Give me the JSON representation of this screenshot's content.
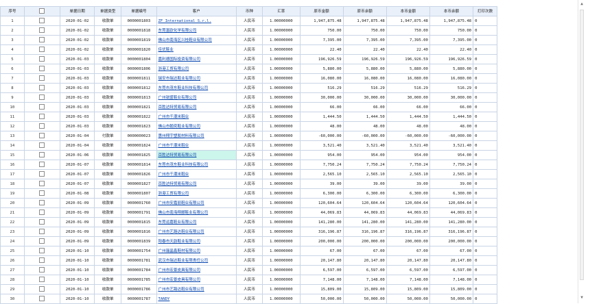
{
  "headers": [
    "序号",
    "",
    "单据日期",
    "单据类型",
    "单据编号",
    "客户",
    "币种",
    "汇率",
    "原币金额",
    "原币余额",
    "本币金额",
    "本币余额",
    "打印次数"
  ],
  "rows": [
    [
      "1",
      "2020-01-02",
      "收款单",
      "0000001803",
      "ZF International S.r.l.",
      "人民币",
      "1.00000000",
      "1,947,875.48",
      "1,947,875.48",
      "1,947,875.48",
      "1,947,875.48",
      "0"
    ],
    [
      "2",
      "2020-01-02",
      "收款单",
      "0000001818",
      "东莞富欧化学有限公司",
      "人民币",
      "1.00000000",
      "750.00",
      "750.00",
      "750.00",
      "750.00",
      "0"
    ],
    [
      "3",
      "2020-01-02",
      "收款单",
      "0000001819",
      "佛山市南海区兴桂鞋业有限公司",
      "人民币",
      "1.00000000",
      "7,395.00",
      "7,395.00",
      "7,395.00",
      "7,395.00",
      "0"
    ],
    [
      "4",
      "2020-01-02",
      "收款单",
      "0000001820",
      "佳优鞋业",
      "人民币",
      "1.00000000",
      "22.40",
      "22.40",
      "22.40",
      "22.40",
      "0"
    ],
    [
      "5",
      "2020-01-03",
      "收款单",
      "0000001804",
      "嘉利德国际投资有限公司",
      "人民币",
      "1.00000000",
      "196,926.59",
      "196,926.59",
      "196,926.59",
      "196,926.59",
      "0"
    ],
    [
      "6",
      "2020-01-03",
      "收款单",
      "0000001806",
      "浙港工贸有限公司",
      "人民币",
      "1.00000000",
      "5,880.00",
      "5,880.00",
      "5,880.00",
      "5,880.00",
      "0"
    ],
    [
      "7",
      "2020-01-03",
      "收款单",
      "0000001811",
      "瑞安市瑞达鞋业有限公司",
      "人民币",
      "1.00000000",
      "16,080.00",
      "16,080.00",
      "16,080.00",
      "16,080.00",
      "0"
    ],
    [
      "8",
      "2020-01-03",
      "收款单",
      "0000001812",
      "东莞市茂东鞋业科技有限公司",
      "人民币",
      "1.00000000",
      "516.29",
      "516.29",
      "516.29",
      "516.29",
      "0"
    ],
    [
      "9",
      "2020-01-03",
      "收款单",
      "0000001813",
      "广州锐盛鞋业有限公司",
      "人民币",
      "1.00000000",
      "30,000.00",
      "30,000.00",
      "30,000.00",
      "30,000.00",
      "0"
    ],
    [
      "10",
      "2020-01-03",
      "收款单",
      "0000001821",
      "百胜达特贸易有限公司",
      "人民币",
      "1.00000000",
      "66.00",
      "66.00",
      "66.00",
      "66.00",
      "0"
    ],
    [
      "11",
      "2020-01-03",
      "收款单",
      "0000001822",
      "广州市千潮米鞋业",
      "人民币",
      "1.00000000",
      "1,444.50",
      "1,444.50",
      "1,444.50",
      "1,444.50",
      "0"
    ],
    [
      "12",
      "2020-01-03",
      "收款单",
      "0000001823",
      "佛山市翰奕鞋业有限公司",
      "人民币",
      "1.00000000",
      "48.00",
      "48.00",
      "48.00",
      "48.00",
      "0"
    ],
    [
      "13",
      "2020-01-04",
      "付款单",
      "0000000023",
      "惠州翔宇塑胶材料有限公司",
      "人民币",
      "1.00000000",
      "-60,000.00",
      "-60,000.00",
      "-60,000.00",
      "-60,000.00",
      "0"
    ],
    [
      "14",
      "2020-01-04",
      "收款单",
      "0000001824",
      "广州市千潮米鞋业",
      "人民币",
      "1.00000000",
      "3,521.40",
      "3,521.40",
      "3,521.40",
      "3,521.40",
      "0"
    ],
    [
      "15",
      "2020-01-06",
      "收款单",
      "0000001825",
      "百胜达特贸易有限公司",
      "人民币",
      "1.00000000",
      "954.00",
      "954.00",
      "954.00",
      "954.00",
      "0"
    ],
    [
      "16",
      "2020-01-07",
      "收款单",
      "0000001814",
      "东莞市茂东鞋业科技有限公司",
      "人民币",
      "1.00000000",
      "7,750.24",
      "7,750.24",
      "7,750.24",
      "7,750.24",
      "0"
    ],
    [
      "17",
      "2020-01-07",
      "收款单",
      "0000001826",
      "广州市千潮米鞋业",
      "人民币",
      "1.00000000",
      "2,565.10",
      "2,565.10",
      "2,565.10",
      "2,565.10",
      "0"
    ],
    [
      "18",
      "2020-01-07",
      "收款单",
      "0000001827",
      "百胜达特贸易有限公司",
      "人民币",
      "1.00000000",
      "39.00",
      "39.00",
      "39.00",
      "39.00",
      "0"
    ],
    [
      "19",
      "2020-01-08",
      "收款单",
      "0000001807",
      "浙港工贸有限公司",
      "人民币",
      "1.00000000",
      "6,300.00",
      "6,300.00",
      "6,300.00",
      "6,300.00",
      "0"
    ],
    [
      "20",
      "2020-01-09",
      "收款单",
      "0000001760",
      "广州市安嘉丽鞋业有限公司",
      "人民币",
      "1.00000000",
      "120,604.64",
      "120,604.64",
      "120,604.64",
      "120,604.64",
      "0"
    ],
    [
      "21",
      "2020-01-09",
      "收款单",
      "0000001791",
      "佛山市南海翔郦鞋业有限公司",
      "人民币",
      "1.00000000",
      "44,069.83",
      "44,069.83",
      "44,069.83",
      "44,069.83",
      "0"
    ],
    [
      "22",
      "2020-01-09",
      "收款单",
      "0000001815",
      "东莞运嘉鞋业有限公司",
      "人民币",
      "1.00000000",
      "141,280.00",
      "141,280.00",
      "141,280.00",
      "141,280.00",
      "0"
    ],
    [
      "23",
      "2020-01-09",
      "收款单",
      "0000001816",
      "广州市艺路达鞋业有限公司",
      "人民币",
      "1.00000000",
      "316,196.87",
      "316,196.87",
      "316,196.87",
      "316,196.87",
      "0"
    ],
    [
      "24",
      "2020-01-09",
      "收款单",
      "0000001839",
      "阳春市天韵鞋业有限公司",
      "人民币",
      "1.00000000",
      "200,000.00",
      "200,000.00",
      "200,000.00",
      "200,000.00",
      "0"
    ],
    [
      "25",
      "2020-01-10",
      "收款单",
      "0000001754",
      "广州骊晶鑫鞋材有限公司",
      "人民币",
      "1.00000000",
      "67.00",
      "67.00",
      "67.00",
      "67.00",
      "0"
    ],
    [
      "26",
      "2020-01-10",
      "收款单",
      "0000001781",
      "武汉市瑞达鞋业有限责任公司",
      "人民币",
      "1.00000000",
      "20,147.80",
      "20,147.80",
      "20,147.80",
      "20,147.80",
      "0"
    ],
    [
      "27",
      "2020-01-10",
      "收款单",
      "0000001784",
      "广州市宏景皮具有限公司",
      "人民币",
      "1.00000000",
      "6,597.00",
      "6,597.00",
      "6,597.00",
      "6,597.00",
      "0"
    ],
    [
      "28",
      "2020-01-10",
      "收款单",
      "0000001785",
      "广州市宏景皮具有限公司",
      "人民币",
      "1.00000000",
      "7,148.00",
      "7,148.00",
      "7,148.00",
      "7,148.00",
      "0"
    ],
    [
      "29",
      "2020-01-10",
      "收款单",
      "0000001786",
      "广州市艺路达鞋业有限公司",
      "人民币",
      "1.00000000",
      "15,809.00",
      "15,809.00",
      "15,809.00",
      "15,809.00",
      "0"
    ],
    [
      "30",
      "2020-01-10",
      "收款单",
      "0000001787",
      "TANDY",
      "人民币",
      "1.00000000",
      "50,000.00",
      "50,000.00",
      "50,000.00",
      "50,000.00",
      "0"
    ]
  ],
  "selected_row": "15",
  "scrollbar": {
    "up_glyph": "▲",
    "down_glyph": "▼"
  }
}
